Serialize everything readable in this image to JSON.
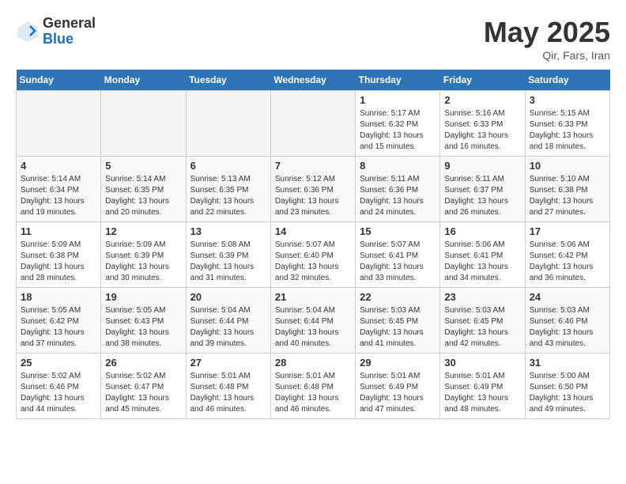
{
  "header": {
    "logo_general": "General",
    "logo_blue": "Blue",
    "month_year": "May 2025",
    "location": "Qir, Fars, Iran"
  },
  "days_of_week": [
    "Sunday",
    "Monday",
    "Tuesday",
    "Wednesday",
    "Thursday",
    "Friday",
    "Saturday"
  ],
  "weeks": [
    [
      {
        "num": "",
        "info": ""
      },
      {
        "num": "",
        "info": ""
      },
      {
        "num": "",
        "info": ""
      },
      {
        "num": "",
        "info": ""
      },
      {
        "num": "1",
        "info": "Sunrise: 5:17 AM\nSunset: 6:32 PM\nDaylight: 13 hours\nand 15 minutes."
      },
      {
        "num": "2",
        "info": "Sunrise: 5:16 AM\nSunset: 6:33 PM\nDaylight: 13 hours\nand 16 minutes."
      },
      {
        "num": "3",
        "info": "Sunrise: 5:15 AM\nSunset: 6:33 PM\nDaylight: 13 hours\nand 18 minutes."
      }
    ],
    [
      {
        "num": "4",
        "info": "Sunrise: 5:14 AM\nSunset: 6:34 PM\nDaylight: 13 hours\nand 19 minutes."
      },
      {
        "num": "5",
        "info": "Sunrise: 5:14 AM\nSunset: 6:35 PM\nDaylight: 13 hours\nand 20 minutes."
      },
      {
        "num": "6",
        "info": "Sunrise: 5:13 AM\nSunset: 6:35 PM\nDaylight: 13 hours\nand 22 minutes."
      },
      {
        "num": "7",
        "info": "Sunrise: 5:12 AM\nSunset: 6:36 PM\nDaylight: 13 hours\nand 23 minutes."
      },
      {
        "num": "8",
        "info": "Sunrise: 5:11 AM\nSunset: 6:36 PM\nDaylight: 13 hours\nand 24 minutes."
      },
      {
        "num": "9",
        "info": "Sunrise: 5:11 AM\nSunset: 6:37 PM\nDaylight: 13 hours\nand 26 minutes."
      },
      {
        "num": "10",
        "info": "Sunrise: 5:10 AM\nSunset: 6:38 PM\nDaylight: 13 hours\nand 27 minutes."
      }
    ],
    [
      {
        "num": "11",
        "info": "Sunrise: 5:09 AM\nSunset: 6:38 PM\nDaylight: 13 hours\nand 28 minutes."
      },
      {
        "num": "12",
        "info": "Sunrise: 5:09 AM\nSunset: 6:39 PM\nDaylight: 13 hours\nand 30 minutes."
      },
      {
        "num": "13",
        "info": "Sunrise: 5:08 AM\nSunset: 6:39 PM\nDaylight: 13 hours\nand 31 minutes."
      },
      {
        "num": "14",
        "info": "Sunrise: 5:07 AM\nSunset: 6:40 PM\nDaylight: 13 hours\nand 32 minutes."
      },
      {
        "num": "15",
        "info": "Sunrise: 5:07 AM\nSunset: 6:41 PM\nDaylight: 13 hours\nand 33 minutes."
      },
      {
        "num": "16",
        "info": "Sunrise: 5:06 AM\nSunset: 6:41 PM\nDaylight: 13 hours\nand 34 minutes."
      },
      {
        "num": "17",
        "info": "Sunrise: 5:06 AM\nSunset: 6:42 PM\nDaylight: 13 hours\nand 36 minutes."
      }
    ],
    [
      {
        "num": "18",
        "info": "Sunrise: 5:05 AM\nSunset: 6:42 PM\nDaylight: 13 hours\nand 37 minutes."
      },
      {
        "num": "19",
        "info": "Sunrise: 5:05 AM\nSunset: 6:43 PM\nDaylight: 13 hours\nand 38 minutes."
      },
      {
        "num": "20",
        "info": "Sunrise: 5:04 AM\nSunset: 6:44 PM\nDaylight: 13 hours\nand 39 minutes."
      },
      {
        "num": "21",
        "info": "Sunrise: 5:04 AM\nSunset: 6:44 PM\nDaylight: 13 hours\nand 40 minutes."
      },
      {
        "num": "22",
        "info": "Sunrise: 5:03 AM\nSunset: 6:45 PM\nDaylight: 13 hours\nand 41 minutes."
      },
      {
        "num": "23",
        "info": "Sunrise: 5:03 AM\nSunset: 6:45 PM\nDaylight: 13 hours\nand 42 minutes."
      },
      {
        "num": "24",
        "info": "Sunrise: 5:03 AM\nSunset: 6:46 PM\nDaylight: 13 hours\nand 43 minutes."
      }
    ],
    [
      {
        "num": "25",
        "info": "Sunrise: 5:02 AM\nSunset: 6:46 PM\nDaylight: 13 hours\nand 44 minutes."
      },
      {
        "num": "26",
        "info": "Sunrise: 5:02 AM\nSunset: 6:47 PM\nDaylight: 13 hours\nand 45 minutes."
      },
      {
        "num": "27",
        "info": "Sunrise: 5:01 AM\nSunset: 6:48 PM\nDaylight: 13 hours\nand 46 minutes."
      },
      {
        "num": "28",
        "info": "Sunrise: 5:01 AM\nSunset: 6:48 PM\nDaylight: 13 hours\nand 46 minutes."
      },
      {
        "num": "29",
        "info": "Sunrise: 5:01 AM\nSunset: 6:49 PM\nDaylight: 13 hours\nand 47 minutes."
      },
      {
        "num": "30",
        "info": "Sunrise: 5:01 AM\nSunset: 6:49 PM\nDaylight: 13 hours\nand 48 minutes."
      },
      {
        "num": "31",
        "info": "Sunrise: 5:00 AM\nSunset: 6:50 PM\nDaylight: 13 hours\nand 49 minutes."
      }
    ]
  ]
}
